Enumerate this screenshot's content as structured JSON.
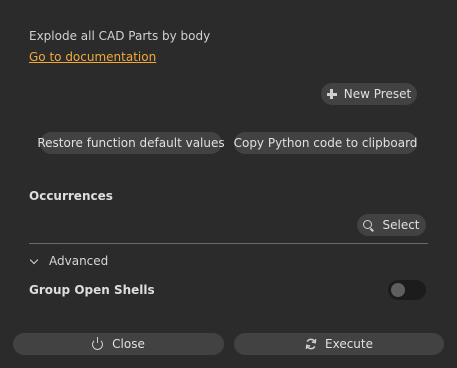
{
  "description": "Explode all CAD Parts by body",
  "doc_link": "Go to documentation",
  "new_preset_label": "New Preset",
  "restore_label": "Restore function default values",
  "copy_label": "Copy Python code to clipboard",
  "occurrences_label": "Occurrences",
  "select_label": "Select",
  "advanced_label": "Advanced",
  "group_open_shells_label": "Group Open Shells",
  "group_open_shells_value": false,
  "close_label": "Close",
  "execute_label": "Execute",
  "colors": {
    "background": "#2b2b2b",
    "button": "#424242",
    "link": "#f2a93b"
  }
}
